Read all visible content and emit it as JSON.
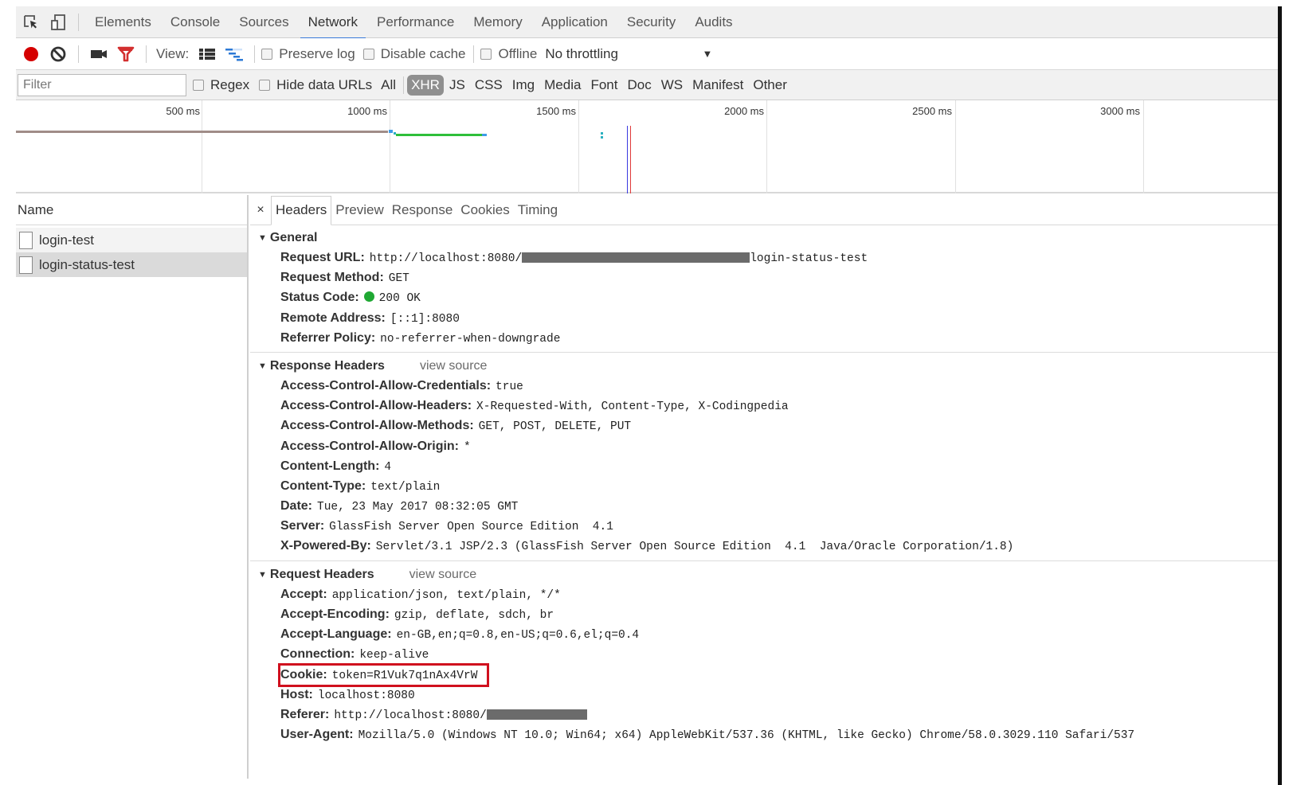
{
  "tabbar": {
    "icons": [
      "inspect-element-icon",
      "device-toolbar-icon"
    ],
    "tabs": [
      {
        "label": "Elements",
        "active": false
      },
      {
        "label": "Console",
        "active": false
      },
      {
        "label": "Sources",
        "active": false
      },
      {
        "label": "Network",
        "active": true
      },
      {
        "label": "Performance",
        "active": false
      },
      {
        "label": "Memory",
        "active": false
      },
      {
        "label": "Application",
        "active": false
      },
      {
        "label": "Security",
        "active": false
      },
      {
        "label": "Audits",
        "active": false
      }
    ]
  },
  "toolbar": {
    "record_color": "#d50000",
    "filter_icon_color": "#d32f2f",
    "view_label": "View:",
    "preserve_log": {
      "label": "Preserve log",
      "checked": false
    },
    "disable_cache": {
      "label": "Disable cache",
      "checked": false
    },
    "offline": {
      "label": "Offline",
      "checked": false
    },
    "throttling": {
      "value": "No throttling",
      "arrow": "▼"
    }
  },
  "filterbar": {
    "filter_placeholder": "Filter",
    "filter_value": "",
    "regex": {
      "label": "Regex",
      "checked": false
    },
    "hide_data_urls": {
      "label": "Hide data URLs",
      "checked": false
    },
    "types": [
      {
        "label": "All",
        "active": false
      },
      {
        "label": "XHR",
        "active": true
      },
      {
        "label": "JS",
        "active": false
      },
      {
        "label": "CSS",
        "active": false
      },
      {
        "label": "Img",
        "active": false
      },
      {
        "label": "Media",
        "active": false
      },
      {
        "label": "Font",
        "active": false
      },
      {
        "label": "Doc",
        "active": false
      },
      {
        "label": "WS",
        "active": false
      },
      {
        "label": "Manifest",
        "active": false
      },
      {
        "label": "Other",
        "active": false
      }
    ]
  },
  "overview": {
    "ticks": [
      "500 ms",
      "1000 ms",
      "1500 ms",
      "2000 ms",
      "2500 ms",
      "3000 ms"
    ],
    "colors": {
      "waiting": "#a08d88",
      "download": "#2fbf3a",
      "queue": "#3d9be9",
      "dom_content_loaded": "#3a3ae0",
      "load": "#e03a3a"
    }
  },
  "requests": {
    "header": "Name",
    "items": [
      {
        "name": "login-test",
        "selected": false
      },
      {
        "name": "login-status-test",
        "selected": true
      }
    ]
  },
  "details": {
    "close": "×",
    "tabs": [
      {
        "label": "Headers",
        "active": true
      },
      {
        "label": "Preview",
        "active": false
      },
      {
        "label": "Response",
        "active": false
      },
      {
        "label": "Cookies",
        "active": false
      },
      {
        "label": "Timing",
        "active": false
      }
    ],
    "general": {
      "title": "General",
      "request_url_key": "Request URL:",
      "request_url_prefix": "http://localhost:8080/",
      "request_url_suffix": "login-status-test",
      "request_method_key": "Request Method:",
      "request_method": "GET",
      "status_code_key": "Status Code:",
      "status_code": "200 OK",
      "status_color": "#1fa833",
      "remote_address_key": "Remote Address:",
      "remote_address": "[::1]:8080",
      "referrer_policy_key": "Referrer Policy:",
      "referrer_policy": "no-referrer-when-downgrade"
    },
    "response_headers": {
      "title": "Response Headers",
      "view_source": "view source",
      "rows": [
        {
          "key": "Access-Control-Allow-Credentials:",
          "value": "true"
        },
        {
          "key": "Access-Control-Allow-Headers:",
          "value": "X-Requested-With, Content-Type, X-Codingpedia"
        },
        {
          "key": "Access-Control-Allow-Methods:",
          "value": "GET, POST, DELETE, PUT"
        },
        {
          "key": "Access-Control-Allow-Origin:",
          "value": "*"
        },
        {
          "key": "Content-Length:",
          "value": "4"
        },
        {
          "key": "Content-Type:",
          "value": "text/plain"
        },
        {
          "key": "Date:",
          "value": "Tue, 23 May 2017 08:32:05 GMT"
        },
        {
          "key": "Server:",
          "value": "GlassFish Server Open Source Edition  4.1"
        },
        {
          "key": "X-Powered-By:",
          "value": "Servlet/3.1 JSP/2.3 (GlassFish Server Open Source Edition  4.1  Java/Oracle Corporation/1.8)"
        }
      ]
    },
    "request_headers": {
      "title": "Request Headers",
      "view_source": "view source",
      "rows": [
        {
          "key": "Accept:",
          "value": "application/json, text/plain, */*"
        },
        {
          "key": "Accept-Encoding:",
          "value": "gzip, deflate, sdch, br"
        },
        {
          "key": "Accept-Language:",
          "value": "en-GB,en;q=0.8,en-US;q=0.6,el;q=0.4"
        },
        {
          "key": "Connection:",
          "value": "keep-alive"
        }
      ],
      "cookie_key": "Cookie:",
      "cookie_value": "token=R1Vuk7q1nAx4VrW",
      "highlight_color": "#d0101e",
      "host_key": "Host:",
      "host_value": "localhost:8080",
      "referer_key": "Referer:",
      "referer_prefix": "http://localhost:8080/",
      "user_agent_key": "User-Agent:",
      "user_agent_value": "Mozilla/5.0 (Windows NT 10.0; Win64; x64) AppleWebKit/537.36 (KHTML, like Gecko) Chrome/58.0.3029.110 Safari/537"
    }
  }
}
